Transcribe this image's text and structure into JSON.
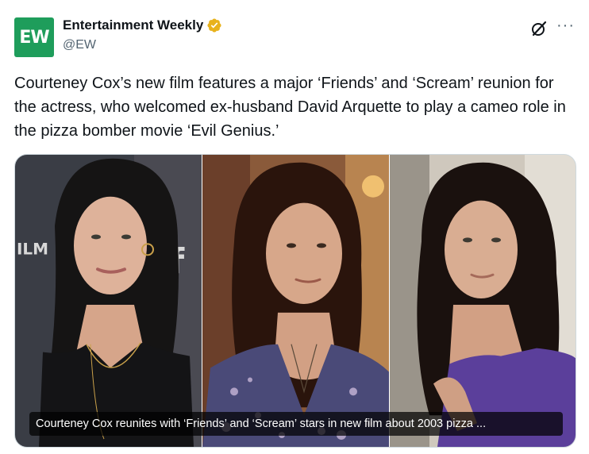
{
  "author": {
    "name": "Entertainment Weekly",
    "handle": "@EW",
    "avatar_text": "EW",
    "verified_icon": "gold-verified-badge"
  },
  "actions": {
    "grok_icon": "grok-icon",
    "more_icon": "more-horizontal-icon",
    "more_label": "···"
  },
  "post": {
    "text": "Courteney Cox’s new film features a major ‘Friends’ and ‘Scream’ reunion for the actress, who welcomed ex-husband David Arquette to play a cameo role in the pizza bomber movie ‘Evil Genius.’"
  },
  "media": {
    "backdrop_text_1": "ILM",
    "backdrop_text_2": "f",
    "caption": "Courteney Cox reunites with ‘Friends’ and ‘Scream’ stars in new film about 2003 pizza ..."
  },
  "colors": {
    "avatar_bg": "#1e9d5b",
    "verified": "#e8b21c",
    "text": "#0f1419",
    "secondary": "#536471"
  }
}
